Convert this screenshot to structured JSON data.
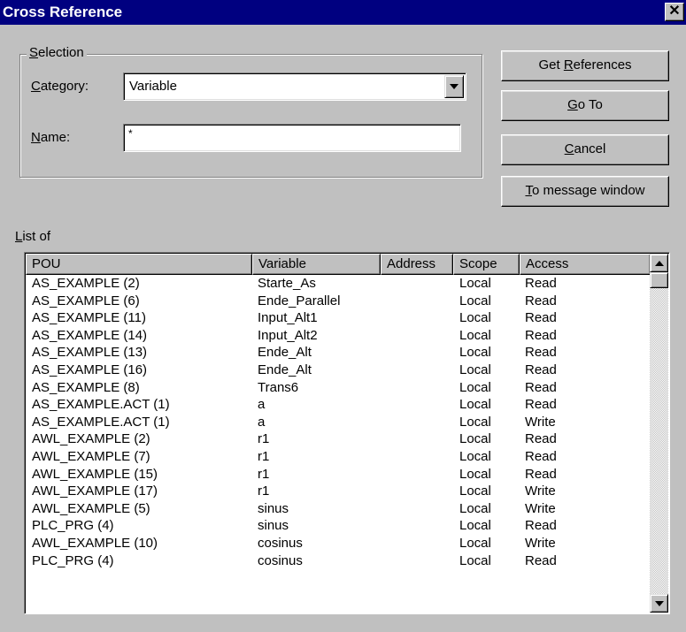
{
  "window": {
    "title": "Cross Reference",
    "close_glyph": "✕"
  },
  "selection": {
    "group_label_ul": "S",
    "group_label_rest": "election",
    "category_label_ul": "C",
    "category_label_rest": "ategory:",
    "category_value": "Variable",
    "name_label_ul": "N",
    "name_label_rest": "ame:",
    "name_value": "*"
  },
  "buttons": {
    "get_refs_pre": "Get ",
    "get_refs_ul": "R",
    "get_refs_post": "eferences",
    "goto_ul": "G",
    "goto_post": "o To",
    "cancel_ul": "C",
    "cancel_post": "ancel",
    "msgwin_ul": "T",
    "msgwin_post": "o message window"
  },
  "list": {
    "label_ul": "L",
    "label_rest": "ist of",
    "columns": [
      "POU",
      "Variable",
      "Address",
      "Scope",
      "Access"
    ],
    "rows": [
      [
        "AS_EXAMPLE (2)",
        "Starte_As",
        "",
        "Local",
        "Read"
      ],
      [
        "AS_EXAMPLE (6)",
        "Ende_Parallel",
        "",
        "Local",
        "Read"
      ],
      [
        "AS_EXAMPLE (11)",
        "Input_Alt1",
        "",
        "Local",
        "Read"
      ],
      [
        "AS_EXAMPLE (14)",
        "Input_Alt2",
        "",
        "Local",
        "Read"
      ],
      [
        "AS_EXAMPLE (13)",
        "Ende_Alt",
        "",
        "Local",
        "Read"
      ],
      [
        "AS_EXAMPLE (16)",
        "Ende_Alt",
        "",
        "Local",
        "Read"
      ],
      [
        "AS_EXAMPLE (8)",
        "Trans6",
        "",
        "Local",
        "Read"
      ],
      [
        "AS_EXAMPLE.ACT (1)",
        "a",
        "",
        "Local",
        "Read"
      ],
      [
        "AS_EXAMPLE.ACT (1)",
        "a",
        "",
        "Local",
        "Write"
      ],
      [
        "AWL_EXAMPLE (2)",
        "r1",
        "",
        "Local",
        "Read"
      ],
      [
        "AWL_EXAMPLE (7)",
        "r1",
        "",
        "Local",
        "Read"
      ],
      [
        "AWL_EXAMPLE (15)",
        "r1",
        "",
        "Local",
        "Read"
      ],
      [
        "AWL_EXAMPLE (17)",
        "r1",
        "",
        "Local",
        "Write"
      ],
      [
        "AWL_EXAMPLE (5)",
        "sinus",
        "",
        "Local",
        "Write"
      ],
      [
        "PLC_PRG (4)",
        "sinus",
        "",
        "Local",
        "Read"
      ],
      [
        "AWL_EXAMPLE (10)",
        "cosinus",
        "",
        "Local",
        "Write"
      ],
      [
        "PLC_PRG (4)",
        "cosinus",
        "",
        "Local",
        "Read"
      ]
    ]
  }
}
